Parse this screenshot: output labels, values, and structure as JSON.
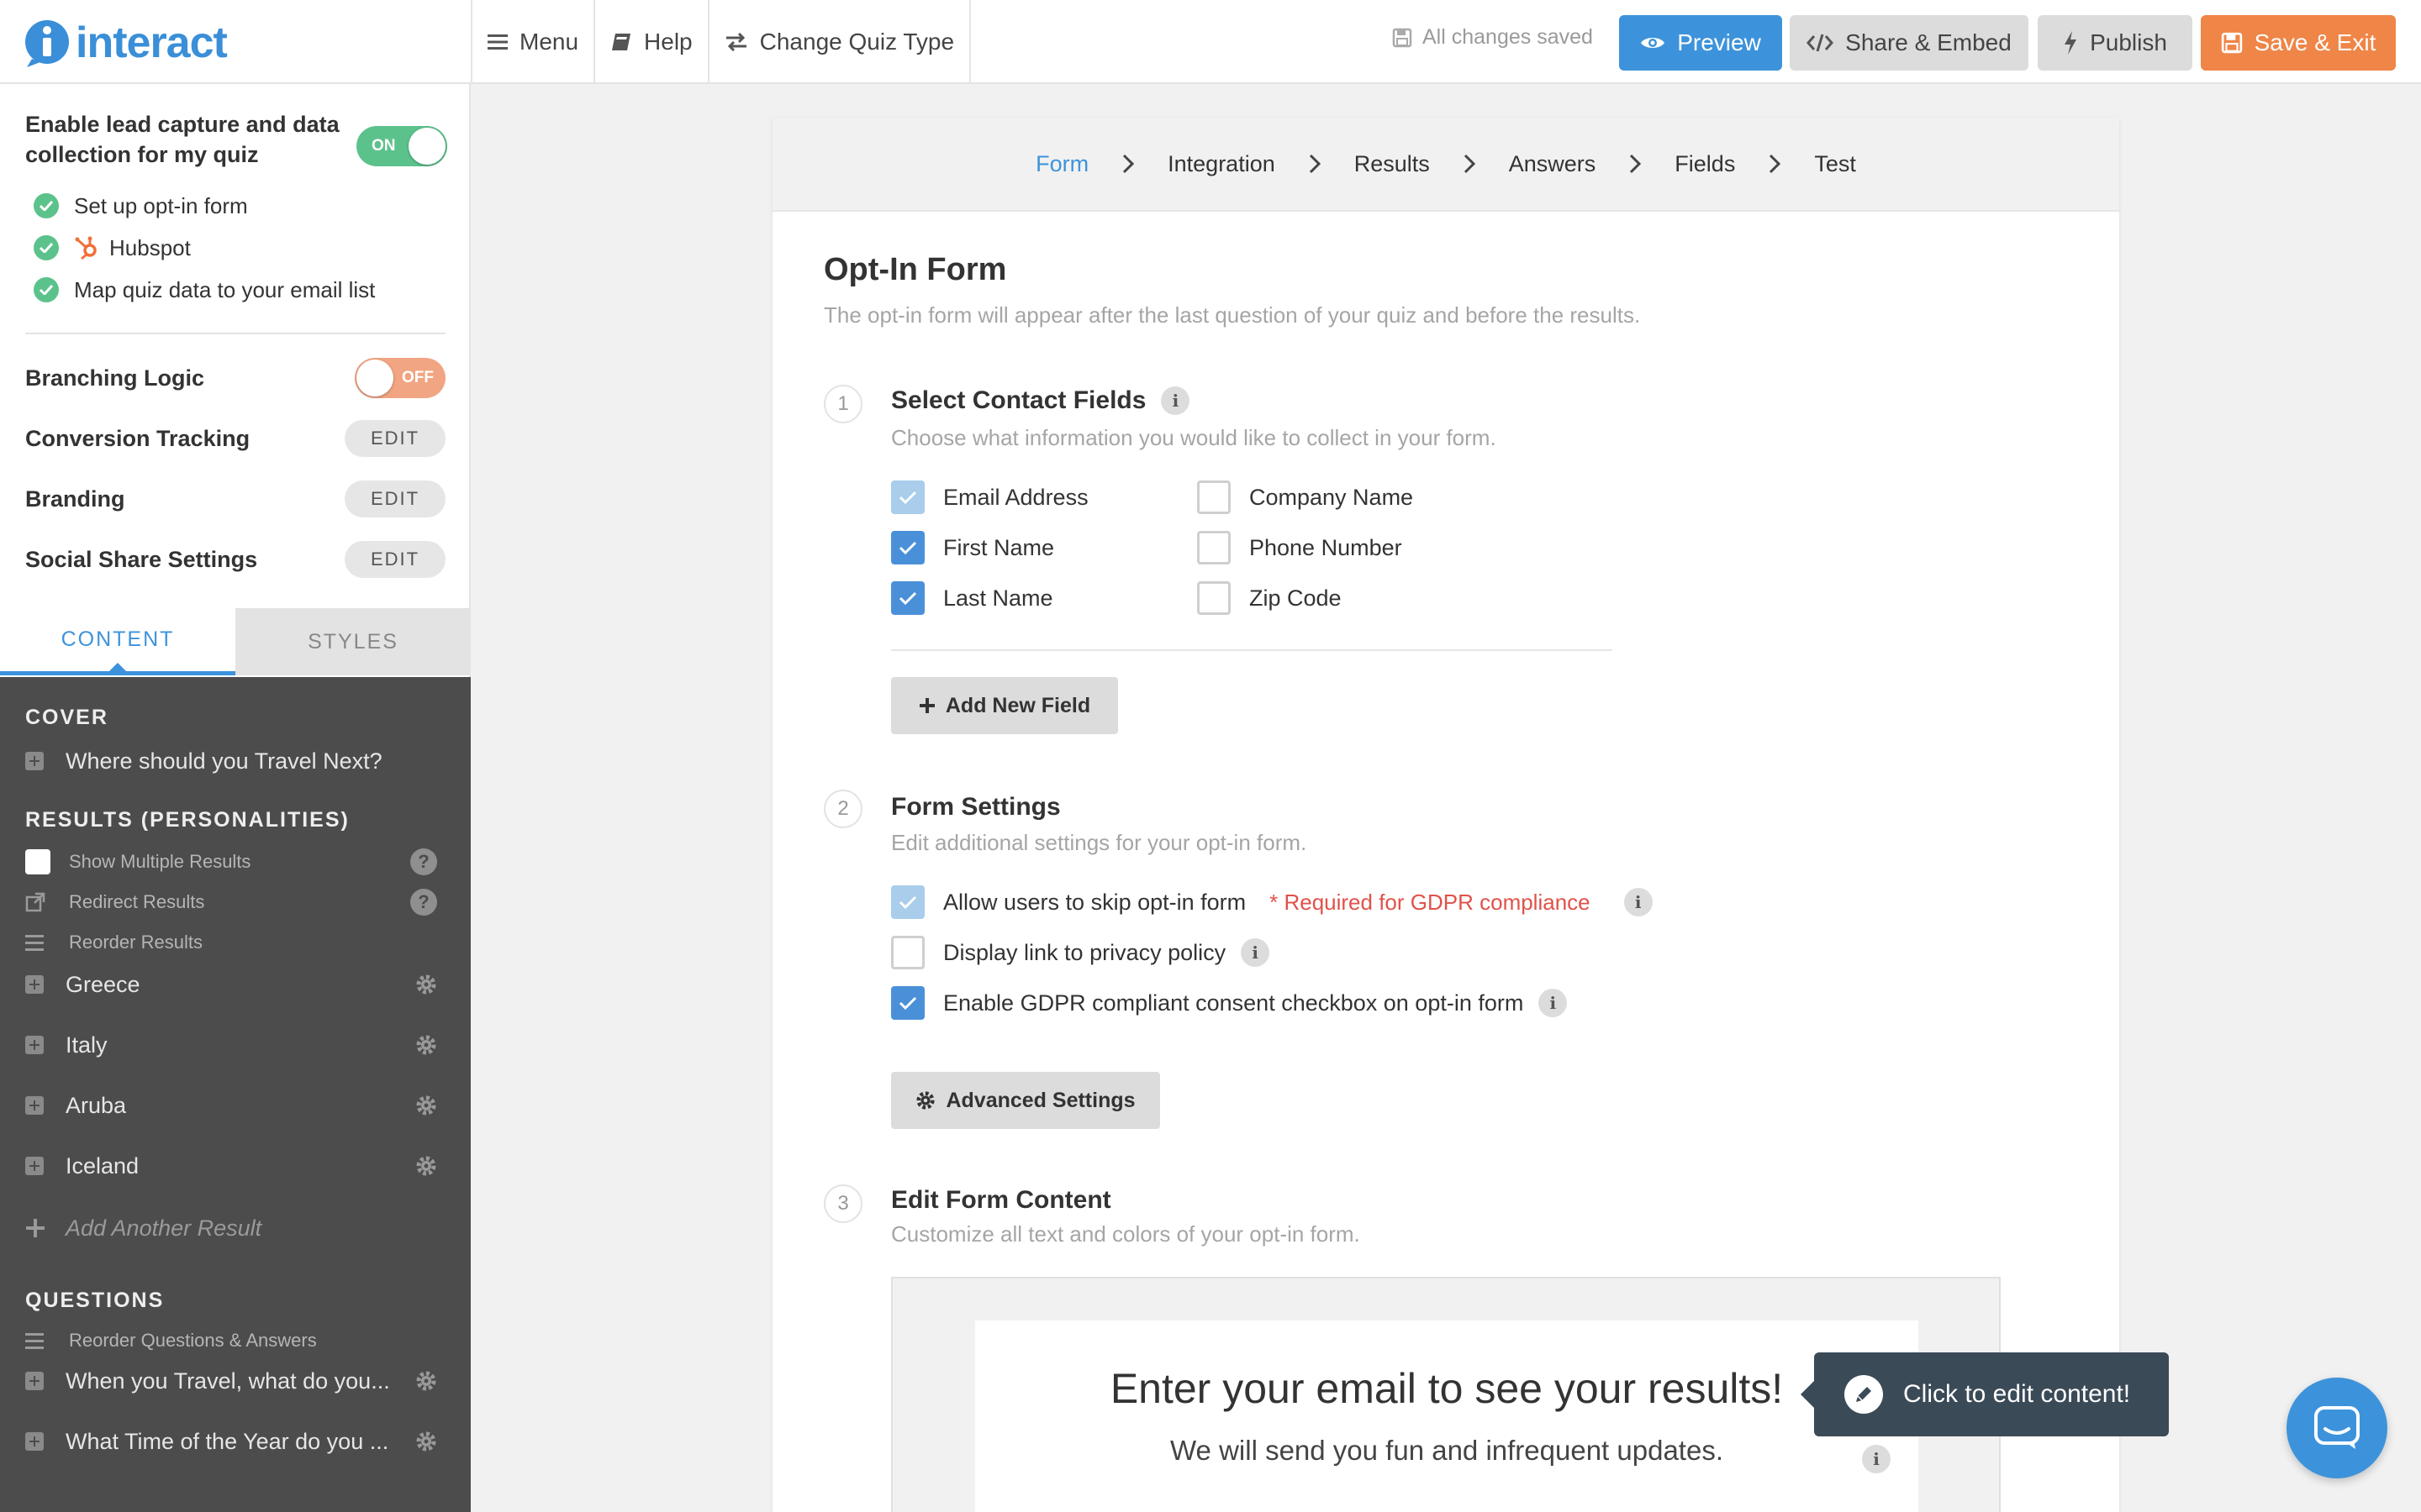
{
  "app": {
    "logo_text": "interact"
  },
  "topnav": {
    "menu": "Menu",
    "help": "Help",
    "change_type": "Change Quiz Type"
  },
  "status": {
    "saved": "All changes saved"
  },
  "actions": {
    "preview": "Preview",
    "share": "Share & Embed",
    "publish": "Publish",
    "save_exit": "Save & Exit"
  },
  "sidebar": {
    "lead_capture": {
      "label": "Enable lead capture and data collection for my quiz",
      "toggle": "ON",
      "items": [
        "Set up opt-in form",
        "Hubspot",
        "Map quiz data to your email list"
      ]
    },
    "branching": {
      "label": "Branching Logic",
      "toggle": "OFF"
    },
    "settings": [
      {
        "label": "Conversion Tracking",
        "button": "EDIT"
      },
      {
        "label": "Branding",
        "button": "EDIT"
      },
      {
        "label": "Social Share Settings",
        "button": "EDIT"
      }
    ],
    "tabs": [
      "CONTENT",
      "STYLES"
    ],
    "cover": {
      "heading": "COVER",
      "item": "Where should you Travel Next?"
    },
    "results": {
      "heading": "RESULTS (PERSONALITIES)",
      "options": [
        "Show Multiple Results",
        "Redirect Results",
        "Reorder Results"
      ],
      "items": [
        "Greece",
        "Italy",
        "Aruba",
        "Iceland"
      ],
      "add": "Add Another Result"
    },
    "questions": {
      "heading": "QUESTIONS",
      "reorder": "Reorder Questions & Answers",
      "items": [
        "When you Travel, what do you...",
        "What Time of the Year do you ..."
      ]
    }
  },
  "breadcrumb": [
    "Form",
    "Integration",
    "Results",
    "Answers",
    "Fields",
    "Test"
  ],
  "main": {
    "title": "Opt-In Form",
    "subtitle": "The opt-in form will appear after the last question of your quiz and before the results.",
    "step1": {
      "num": "1",
      "title": "Select Contact Fields",
      "sub": "Choose what information you would like to collect in your form.",
      "fields_left": [
        {
          "label": "Email Address",
          "state": "dim"
        },
        {
          "label": "First Name",
          "state": "on"
        },
        {
          "label": "Last Name",
          "state": "on"
        }
      ],
      "fields_right": [
        {
          "label": "Company Name",
          "state": "off"
        },
        {
          "label": "Phone Number",
          "state": "off"
        },
        {
          "label": "Zip Code",
          "state": "off"
        }
      ],
      "add_button": "Add New Field"
    },
    "step2": {
      "num": "2",
      "title": "Form Settings",
      "sub": "Edit additional settings for your opt-in form.",
      "opt1": "Allow users to skip opt-in form",
      "opt1_note": "* Required for GDPR compliance",
      "opt2": "Display link to privacy policy",
      "opt3": "Enable GDPR compliant consent checkbox on opt-in form",
      "adv_button": "Advanced Settings"
    },
    "step3": {
      "num": "3",
      "title": "Edit Form Content",
      "sub": "Customize all text and colors of your opt-in form.",
      "preview_title": "Enter your email to see your results!",
      "preview_sub": "We will send you fun and infrequent updates."
    }
  },
  "tooltip": {
    "text": "Click to edit content!"
  },
  "colors": {
    "accent": "#3d93db",
    "orange": "#ef8547",
    "green": "#5cc28c",
    "dark_panel": "#4c4c4c",
    "gdpr_red": "#e0524a"
  }
}
